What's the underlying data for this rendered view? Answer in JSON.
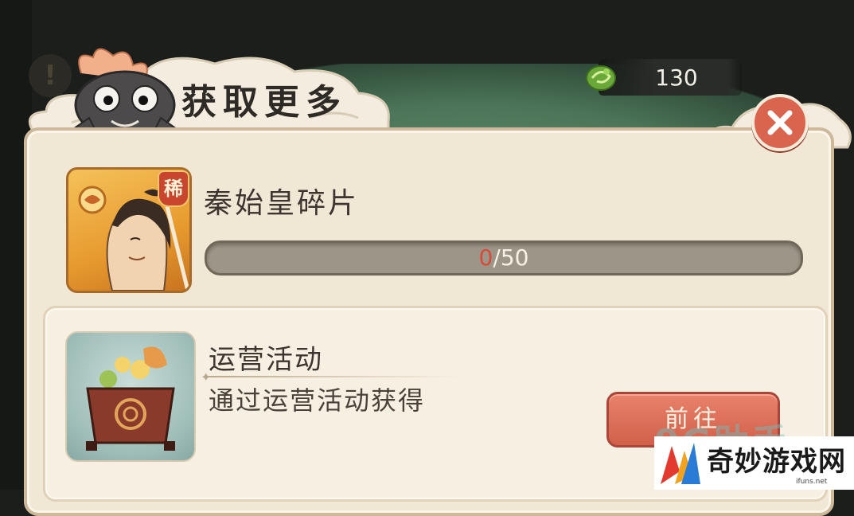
{
  "header": {
    "title": "获取更多",
    "currency": {
      "icon": "jade-dragon-icon",
      "value": "130"
    },
    "close_icon": "close-icon"
  },
  "item": {
    "name": "秦始皇碎片",
    "rarity_badge": "稀",
    "progress": {
      "current": "0",
      "separator": "/",
      "total": "50",
      "fraction": 0
    }
  },
  "sources": [
    {
      "title": "运营活动",
      "description": "通过运营活动获得",
      "icon": "treasure-chest-icon",
      "button_label": "前往"
    }
  ],
  "watermark": {
    "faded_text": "9G助手",
    "site_name": "奇妙游戏网",
    "site_url": "ifuns.net"
  },
  "colors": {
    "panel_bg": "#f1e7d5",
    "button_red": "#d1604a",
    "progress_track": "#9d9587",
    "progress_current": "#d64b3a"
  }
}
